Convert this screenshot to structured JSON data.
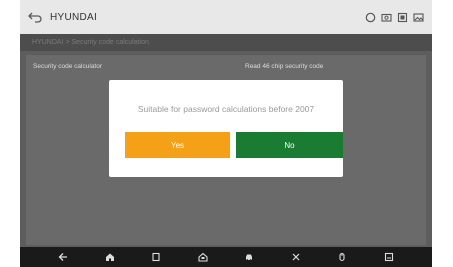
{
  "header": {
    "brand": "HYUNDAI",
    "icons": [
      "back-arrow-icon",
      "circle-icon",
      "camera-icon",
      "screenshot-icon",
      "gallery-icon"
    ]
  },
  "breadcrumb": "HYUNDAI > Security code calculation",
  "list": {
    "left_item": "Security code calculator",
    "right_item": "Read 46 chip security code"
  },
  "dialog": {
    "message": "Suitable for password calculations before 2007",
    "yes_label": "Yes",
    "no_label": "No"
  },
  "navbar": {
    "icons": [
      "back-icon",
      "home-icon",
      "recent-apps-icon",
      "vci-home-icon",
      "car-icon",
      "tools-icon",
      "cursor-icon",
      "screenshot-icon"
    ]
  },
  "colors": {
    "yes": "#f4a118",
    "no": "#1a7c32",
    "overlay": "#5d5d5d"
  }
}
